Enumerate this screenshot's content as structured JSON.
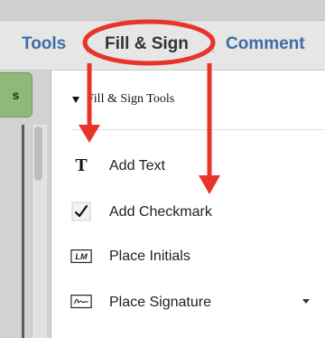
{
  "toolbar": {
    "tabs": [
      {
        "label": "Tools"
      },
      {
        "label": "Fill & Sign"
      },
      {
        "label": "Comment"
      }
    ]
  },
  "left_panel": {
    "button_label": "s"
  },
  "fill_sign": {
    "header": "Fill & Sign Tools",
    "items": [
      {
        "label": "Add Text",
        "icon": "text-t-icon"
      },
      {
        "label": "Add Checkmark",
        "icon": "checkmark-icon"
      },
      {
        "label": "Place Initials",
        "icon": "initials-lm-icon"
      },
      {
        "label": "Place Signature",
        "icon": "signature-pen-icon"
      }
    ]
  },
  "annotation": {
    "color": "#e8352b"
  }
}
